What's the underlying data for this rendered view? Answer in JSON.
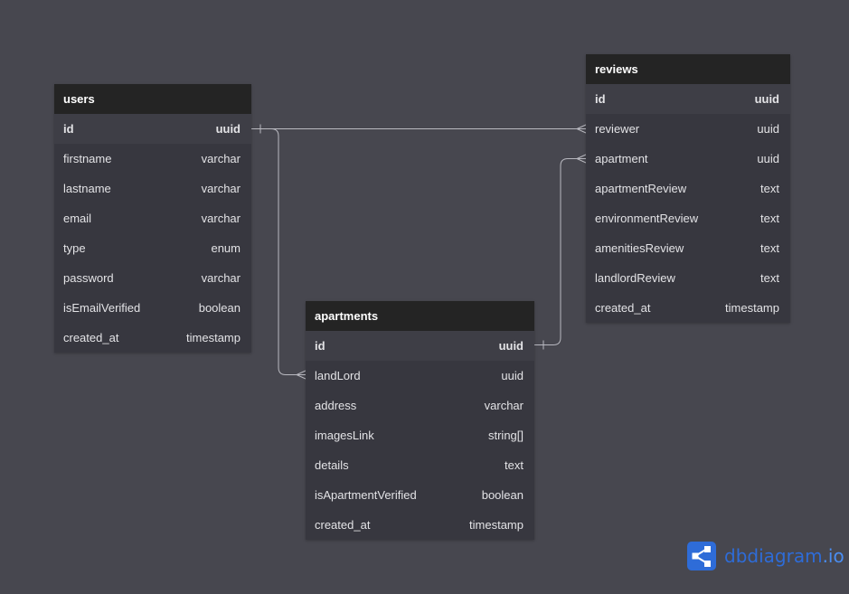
{
  "tables": [
    {
      "key": "users",
      "name": "users",
      "fields": [
        {
          "name": "id",
          "type": "uuid",
          "pk": true
        },
        {
          "name": "firstname",
          "type": "varchar",
          "pk": false
        },
        {
          "name": "lastname",
          "type": "varchar",
          "pk": false
        },
        {
          "name": "email",
          "type": "varchar",
          "pk": false
        },
        {
          "name": "type",
          "type": "enum",
          "pk": false
        },
        {
          "name": "password",
          "type": "varchar",
          "pk": false
        },
        {
          "name": "isEmailVerified",
          "type": "boolean",
          "pk": false
        },
        {
          "name": "created_at",
          "type": "timestamp",
          "pk": false
        }
      ]
    },
    {
      "key": "reviews",
      "name": "reviews",
      "fields": [
        {
          "name": "id",
          "type": "uuid",
          "pk": true
        },
        {
          "name": "reviewer",
          "type": "uuid",
          "pk": false
        },
        {
          "name": "apartment",
          "type": "uuid",
          "pk": false
        },
        {
          "name": "apartmentReview",
          "type": "text",
          "pk": false
        },
        {
          "name": "environmentReview",
          "type": "text",
          "pk": false
        },
        {
          "name": "amenitiesReview",
          "type": "text",
          "pk": false
        },
        {
          "name": "landlordReview",
          "type": "text",
          "pk": false
        },
        {
          "name": "created_at",
          "type": "timestamp",
          "pk": false
        }
      ]
    },
    {
      "key": "apartments",
      "name": "apartments",
      "fields": [
        {
          "name": "id",
          "type": "uuid",
          "pk": true
        },
        {
          "name": "landLord",
          "type": "uuid",
          "pk": false
        },
        {
          "name": "address",
          "type": "varchar",
          "pk": false
        },
        {
          "name": "imagesLink",
          "type": "string[]",
          "pk": false
        },
        {
          "name": "details",
          "type": "text",
          "pk": false
        },
        {
          "name": "isApartmentVerified",
          "type": "boolean",
          "pk": false
        },
        {
          "name": "created_at",
          "type": "timestamp",
          "pk": false
        }
      ]
    }
  ],
  "relations": [
    {
      "from": "users.id",
      "to": "reviews.reviewer",
      "cardinality": "one-to-many"
    },
    {
      "from": "users.id",
      "to": "apartments.landLord",
      "cardinality": "one-to-many"
    },
    {
      "from": "apartments.id",
      "to": "reviews.apartment",
      "cardinality": "one-to-many"
    }
  ],
  "brand": {
    "name": "dbdiagram",
    "tld": ".io",
    "icon": "share-nodes-icon"
  },
  "colors": {
    "canvas": "#47474f",
    "table_header": "#242424",
    "table_body": "#37373f",
    "pk_row": "#3e3e46",
    "relation_line": "#b9b9c0",
    "brand": "#2e6cd8"
  }
}
